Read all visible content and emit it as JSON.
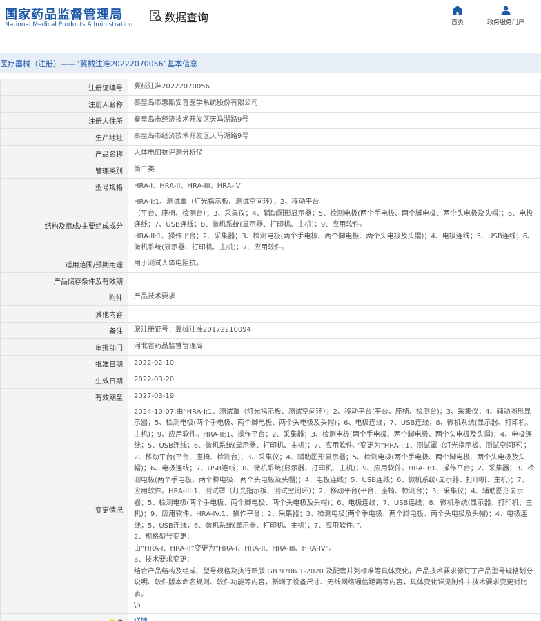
{
  "header": {
    "logo_cn": "国家药品监督管理局",
    "logo_en": "National Medical Products Administration",
    "query_title": "数据查询",
    "nav": [
      {
        "label": "首页",
        "icon": "home-icon"
      },
      {
        "label": "政务服务门户",
        "icon": "user-icon"
      }
    ]
  },
  "breadcrumb": "医疗器械（注册）——“冀械注准20222070056”基本信息",
  "colors": {
    "brand": "#1e5aa8",
    "label_bg": "#f4f4f4",
    "bar_bg": "#e8eef7"
  },
  "details": [
    {
      "label": "注册证编号",
      "value": "冀械注准20222070056"
    },
    {
      "label": "注册人名称",
      "value": "秦皇岛市惠斯安普医学系统股份有限公司"
    },
    {
      "label": "注册人住所",
      "value": "秦皇岛市经济技术开发区天马湖路9号"
    },
    {
      "label": "生产地址",
      "value": "秦皇岛市经济技术开发区天马湖路9号"
    },
    {
      "label": "产品名称",
      "value": "人体电阻抗评测分析仪"
    },
    {
      "label": "管理类别",
      "value": "第二类"
    },
    {
      "label": "型号规格",
      "value": "HRA-I、HRA-II、HRA-III、HRA-IV"
    },
    {
      "label": "结构及组成/主要组成成分",
      "value": "HRA-I:1、测试罩（灯光指示板、测试空间环）；2、移动平台\n（平台、座椅、检测台）；3、采集仪；4、辅助图形显示器；5、检测电极(两个手电极、两个脚电极、两个头电极及头帽)；6、电极连线；7、USB连线；8、微机系统(显示器、打印机、主机)；9、应用软件。\nHRA-II:1、操作平台；2、采集器；3、检测电极(两个手电极、两个脚电极、两个头电极及头帽)；4、电极连线；5、USB连线；6、微机系统(显示器、打印机、主机)；7、应用软件。"
    },
    {
      "label": "适用范围/预期用途",
      "value": "用于测试人体电阻抗。"
    },
    {
      "label": "产品储存条件及有效期",
      "value": ""
    },
    {
      "label": "附件",
      "value": "产品技术要求"
    },
    {
      "label": "其他内容",
      "value": ""
    },
    {
      "label": "备注",
      "value": "原注册证号：冀械注准20172210094"
    },
    {
      "label": "审批部门",
      "value": "河北省药品监督管理局"
    },
    {
      "label": "批准日期",
      "value": "2022-02-10"
    },
    {
      "label": "生效日期",
      "value": "2022-03-20"
    },
    {
      "label": "有效期至",
      "value": "2027-03-19"
    },
    {
      "label": "变更情况",
      "value": "2024-10-07:由“HRA-I:1、测试罩（灯光指示板、测试空间环）；2、移动平台(平台、座椅、检测台)；3、采集仪；4、辅助图形显示器；5、检测电极(两个手电极、两个脚电极、两个头电极及头帽)；6、电极连线；7、USB连线；8、微机系统(显示器、打印机、主机)；9、应用软件。HRA-II:1、操作平台；2、采集器；3、检测电极(两个手电极、两个脚电极、两个头电极及头帽)；4、电极连线；5、USB连线；6、微机系统(显示器、打印机、主机)；7、应用软件。”变更为“HRA-I:1、测试罩（灯光指示板、测试空间环）；2、移动平台(平台、座椅、检测台)；3、采集仪；4、辅助图形显示器；5、检测电极(两个手电极、两个脚电极、两个头电极及头帽)；6、电极连线；7、USB连线；8、微机系统(显示器、打印机、主机)；9、应用软件。HRA-II:1、操作平台；2、采集器；3、检测电极(两个手电极、两个脚电极、两个头电极及头帽)；4、电极连线；5、USB连线；6、微机系统(显示器、打印机、主机)；7、应用软件。HRA-III:1、测试罩（灯光指示板、测试空间环）；2、移动平台(平台、座椅、检测台)；3、采集仪；4、辅助图形显示器；5、检测电极(两个手电极、两个脚电极、两个头电极及头帽)；6、电极连线；7、USB连线；8、微机系统(显示器、打印机、主机)；9、应用软件。HRA-IV:1、操作平台；2、采集器；3、检测电极(两个手电极、两个脚电极、两个头电极及头帽)；4、电极连线；5、USB连线；6、微机系统(显示器、打印机、主机)；7、应用软件。”。\n2、规格型号变更：\n由“HRA-I、HRA-II”变更为“HRA-I、HRA-II、HRA-III、HRA-IV”。\n3、技术要求变更：\n结合产品结构及组成、型号规格及执行新版 GB 9706.1-2020 及配套并列标准等具体变化，产品技术要求修订了产品型号规格划分说明、软件版本命名规则、软件功能等内容，新增了设备尺寸、无线网络通信距离等内容，具体变化详见附件中技术要求变更对比表。\n\\n"
    },
    {
      "label": "注",
      "value": "详情",
      "icon": "lightbulb-icon",
      "is_link": true
    }
  ]
}
